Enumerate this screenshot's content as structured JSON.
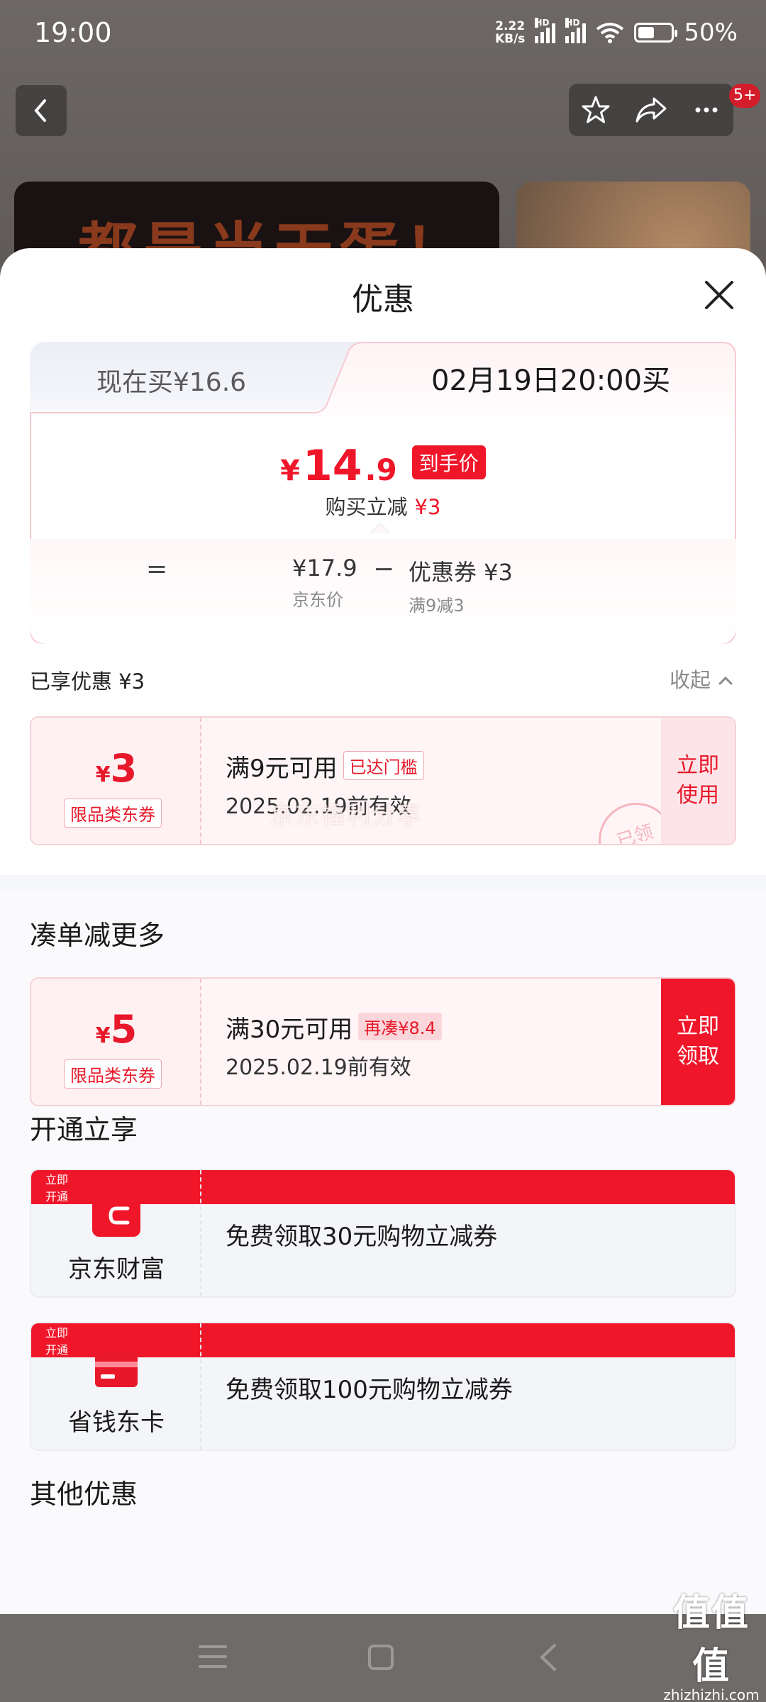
{
  "status": {
    "time": "19:00",
    "net_speed_value": "2.22",
    "net_speed_unit": "KB/s",
    "hd1": "HD",
    "hd2": "HD",
    "battery": "50%",
    "battery_level": 0.5
  },
  "background": {
    "badge": "5+",
    "banner_text": "都是当天蛋！"
  },
  "sheet": {
    "title": "优惠",
    "tabs": {
      "now": "现在买¥16.6",
      "later": "02月19日20:00买"
    },
    "price": {
      "symbol": "¥",
      "integer": "14",
      "decimal": ".9",
      "tag": "到手价",
      "cut_label": "购买立减",
      "cut_value": "¥3"
    },
    "formula": {
      "eq": "=",
      "minus": "−",
      "jd_price": "¥17.9",
      "jd_price_label": "京东价",
      "coupon": "优惠券 ¥3",
      "coupon_label": "满9减3"
    },
    "enjoyed": {
      "label": "已享优惠 ¥3",
      "collapse": "收起"
    },
    "coupon1": {
      "symbol": "¥",
      "amount": "3",
      "type": "限品类东券",
      "condition": "满9元可用",
      "tag": "已达门槛",
      "valid": "2025.02.19前有效",
      "action": "立即使用",
      "stamp": "已领"
    },
    "watermark": "京东福利分享",
    "section_more": "凑单减更多",
    "coupon2": {
      "symbol": "¥",
      "amount": "5",
      "type": "限品类东券",
      "condition": "满30元可用",
      "tag": "再凑¥8.4",
      "valid": "2025.02.19前有效",
      "action": "立即领取"
    },
    "section_open": "开通立享",
    "service1": {
      "name": "京东财富",
      "desc": "免费领取30元购物立减券",
      "action": "立即开通"
    },
    "service2": {
      "name": "省钱东卡",
      "desc": "免费领取100元购物立减券",
      "action": "立即开通"
    },
    "section_other": "其他优惠"
  },
  "brand": {
    "logo": "值值值",
    "domain": "zhizhizhi.com"
  },
  "colors": {
    "accent": "#f0162a",
    "soft_accent": "#fde4e8"
  }
}
